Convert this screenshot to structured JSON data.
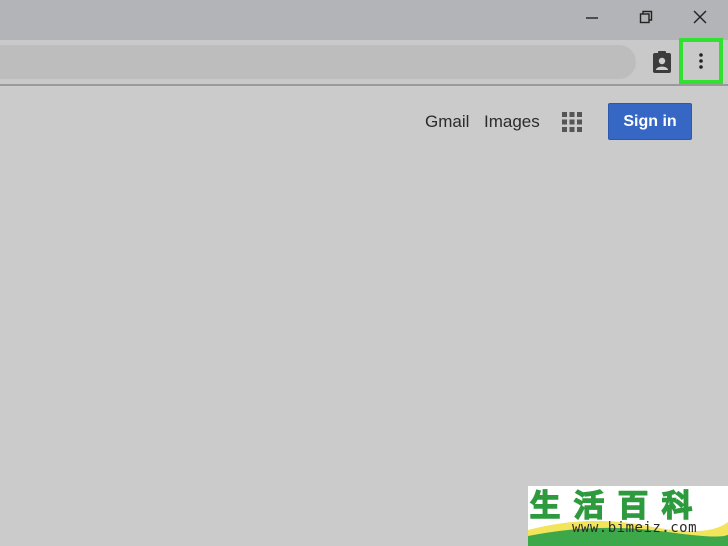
{
  "window": {
    "controls": [
      "minimize-icon",
      "restore-icon",
      "close-icon"
    ]
  },
  "toolbar": {
    "profile_icon": "clipboard-person-icon",
    "menu_icon": "three-dot-vertical-icon",
    "menu_highlight_color": "#32e032"
  },
  "header": {
    "gmail_label": "Gmail",
    "images_label": "Images",
    "apps_icon": "apps-grid-icon",
    "signin_label": "Sign in"
  },
  "watermark": {
    "logo_text": "生活百科",
    "url": "www.bimeiz.com"
  },
  "colors": {
    "page_bg": "#cbcbcb",
    "titlebar_bg": "#b3b4b7",
    "signin_bg": "#3667c4"
  }
}
